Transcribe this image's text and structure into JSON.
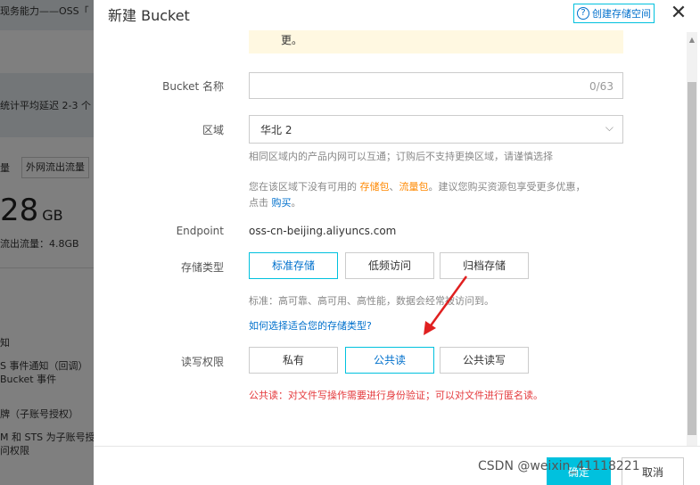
{
  "background": {
    "line1": "现务能力——OSS「",
    "line2": "统计平均延迟 2-3 个",
    "tab_label": "外网流出流量",
    "big_value": "28",
    "big_unit": "GB",
    "sub_value": "流出流量：4.8GB",
    "section1": "知",
    "event1": "S 事件通知（回调）",
    "event2": "Bucket 事件",
    "section2": "牌（子账号授权）",
    "ram1": "M 和 STS 为子账号授",
    "ram2": "问权限"
  },
  "drawer": {
    "title": "新建 Bucket",
    "create_link": "创建存储空间",
    "help_glyph": "?",
    "close_glyph": "✕",
    "notice_text": "更。"
  },
  "form": {
    "name_label": "Bucket 名称",
    "name_value": "",
    "name_counter": "0/63",
    "region_label": "区域",
    "region_value": "华北 2",
    "region_chevron": "⌵",
    "region_help": "相同区域内的产品内网可以互通；订购后不支持更换区域，请谨慎选择",
    "resource_help_prefix": "您在该区域下没有可用的",
    "resource_help_pkg1": "存储包",
    "resource_help_sep": "、",
    "resource_help_pkg2": "流量包",
    "resource_help_suffix": "。建议您购买资源包享受更多优惠，",
    "resource_help_line2_prefix": "点击",
    "resource_help_buy": "购买",
    "resource_help_line2_suffix": "。",
    "endpoint_label": "Endpoint",
    "endpoint_value": "oss-cn-beijing.aliyuncs.com",
    "storage_label": "存储类型",
    "storage_options": [
      "标准存储",
      "低频访问",
      "归档存储"
    ],
    "storage_selected": "标准存储",
    "storage_help": "标准：高可靠、高可用、高性能，数据会经常被访问到。",
    "storage_link": "如何选择适合您的存储类型?",
    "acl_label": "读写权限",
    "acl_options": [
      "私有",
      "公共读",
      "公共读写"
    ],
    "acl_selected": "公共读",
    "acl_warning": "公共读：对文件写操作需要进行身份验证；可以对文件进行匿名读。"
  },
  "footer": {
    "ok_label": "确定",
    "cancel_label": "取消"
  },
  "watermark": {
    "csdn": "CSDN @weixin_41118221"
  },
  "colors": {
    "accent": "#00c1de",
    "link": "#0070cc",
    "warning": "#e4393c",
    "highlight": "#ff8800",
    "arrow": "#e02020"
  }
}
